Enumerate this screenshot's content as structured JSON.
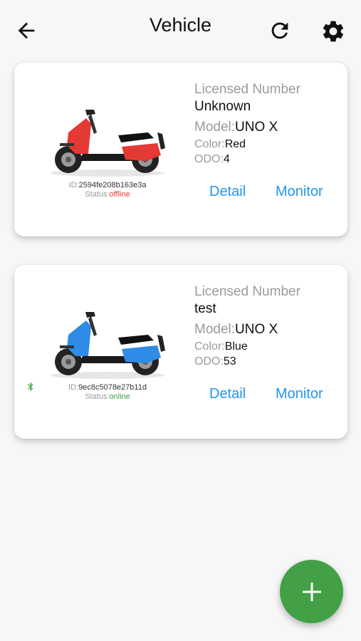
{
  "appbar": {
    "title": "Vehicle",
    "back_icon": "arrow-back-icon",
    "refresh_icon": "refresh-icon",
    "settings_icon": "gear-icon"
  },
  "vehicles": [
    {
      "licensed_label": "Licensed Number",
      "licensed_value": "Unknown",
      "model_label": "Model:",
      "model_value": "UNO X",
      "color_label": "Color:",
      "color_value": "Red",
      "odo_label": "ODO:",
      "odo_value": "4",
      "id_label": "ID:",
      "id_value": "2594fe208b163e3a",
      "status_label": "Status:",
      "status_value": "offline",
      "detail_label": "Detail",
      "monitor_label": "Monitor",
      "body_color": "#e53935",
      "bluetooth": false
    },
    {
      "licensed_label": "Licensed Number",
      "licensed_value": "test",
      "model_label": "Model:",
      "model_value": "UNO X",
      "color_label": "Color:",
      "color_value": "Blue",
      "odo_label": "ODO:",
      "odo_value": "53",
      "id_label": "ID:",
      "id_value": "9ec8c5078e27b11d",
      "status_label": "Status:",
      "status_value": "online",
      "detail_label": "Detail",
      "monitor_label": "Monitor",
      "body_color": "#2e8be6",
      "bluetooth": true
    }
  ],
  "fab": {
    "icon": "plus-icon",
    "color": "#43a047"
  },
  "colors": {
    "accent": "#2196f3",
    "offline": "#e53935",
    "online": "#43a047"
  }
}
